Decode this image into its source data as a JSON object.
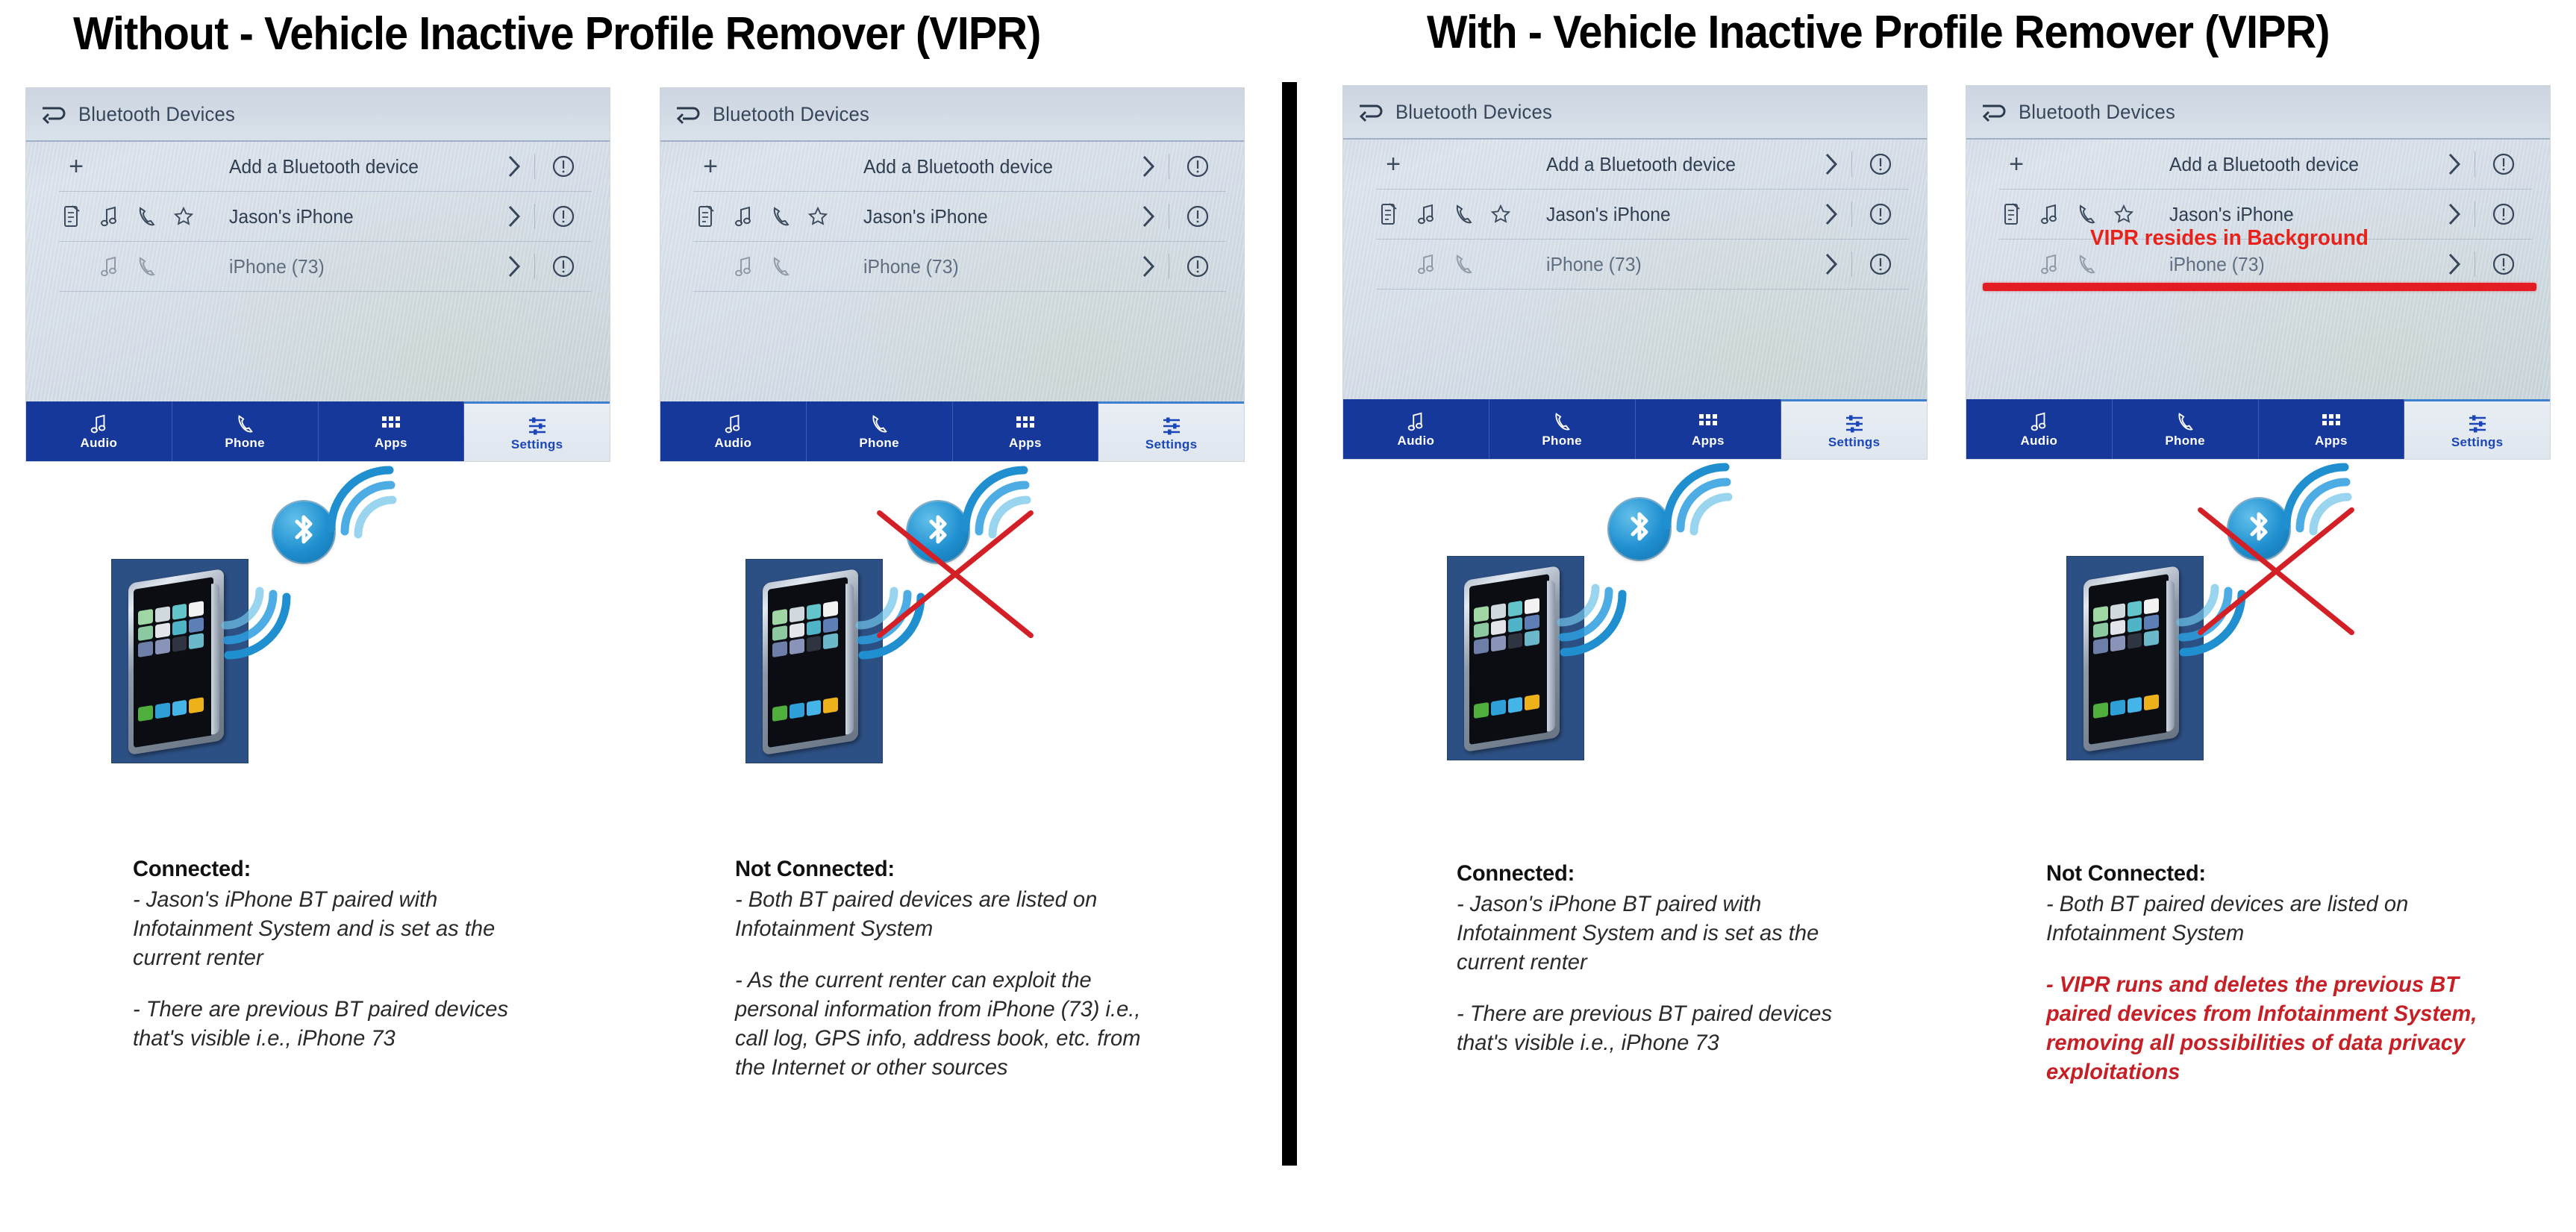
{
  "titles": {
    "left": "Without - Vehicle Inactive Profile Remover (VIPR)",
    "right": "With - Vehicle Inactive Profile Remover (VIPR)"
  },
  "head_unit": {
    "screen_title": "Bluetooth Devices",
    "back_icon": "back-arrow-icon",
    "rows": [
      {
        "label": "Add a Bluetooth device",
        "leading_icons": [
          "plus-icon"
        ],
        "chevron": "chevron-right-icon",
        "info": "info-circle-icon"
      },
      {
        "label": "Jason's iPhone",
        "leading_icons": [
          "phone-contacts-icon",
          "music-note-icon",
          "handset-icon",
          "star-icon"
        ],
        "chevron": "chevron-right-icon",
        "info": "info-circle-icon"
      },
      {
        "label": "iPhone (73)",
        "leading_icons": [
          "music-note-icon",
          "handset-icon"
        ],
        "chevron": "chevron-right-icon",
        "info": "info-circle-icon"
      }
    ],
    "nav": [
      {
        "label": "Audio",
        "icon": "music-note-icon"
      },
      {
        "label": "Phone",
        "icon": "handset-icon"
      },
      {
        "label": "Apps",
        "icon": "app-grid-icon"
      },
      {
        "label": "Settings",
        "icon": "sliders-icon"
      }
    ]
  },
  "annotations": {
    "vipr_background_note": "VIPR resides in Background",
    "strike_color": "#e31b23",
    "red_x_color": "#d32027"
  },
  "panels": [
    {
      "id": "without-connected",
      "heading": "Connected:",
      "paragraphs": [
        "- Jason's iPhone BT paired with Infotainment System and is set as the current renter",
        "- There are previous BT paired devices that's visible i.e., iPhone 73"
      ],
      "paragraph_styles": [
        "normal",
        "normal"
      ],
      "bluetooth_active": true
    },
    {
      "id": "without-not-connected",
      "heading": "Not Connected:",
      "paragraphs": [
        "- Both BT paired devices are listed on Infotainment System",
        "- As the current renter can exploit the personal information from iPhone (73) i.e., call log, GPS info, address book, etc. from the Internet or other sources"
      ],
      "paragraph_styles": [
        "normal",
        "normal"
      ],
      "bluetooth_active": false
    },
    {
      "id": "with-connected",
      "heading": "Connected:",
      "paragraphs": [
        "- Jason's iPhone BT paired with Infotainment System and is set as the current renter",
        "- There are previous BT paired devices that's visible i.e., iPhone 73"
      ],
      "paragraph_styles": [
        "normal",
        "normal"
      ],
      "bluetooth_active": true
    },
    {
      "id": "with-not-connected",
      "heading": "Not Connected:",
      "paragraphs": [
        "- Both BT paired devices are listed on Infotainment System",
        "- VIPR runs and deletes the previous BT paired devices from Infotainment System, removing all possibilities of data privacy exploitations"
      ],
      "paragraph_styles": [
        "normal",
        "red"
      ],
      "bluetooth_active": false
    }
  ],
  "colors": {
    "nav_blue": "#16389b",
    "screen_bg": "#d3dbe6",
    "phone_card_blue": "#2d5084",
    "bluetooth_blue": "#1f8fd0",
    "red_accent": "#e8211b"
  }
}
